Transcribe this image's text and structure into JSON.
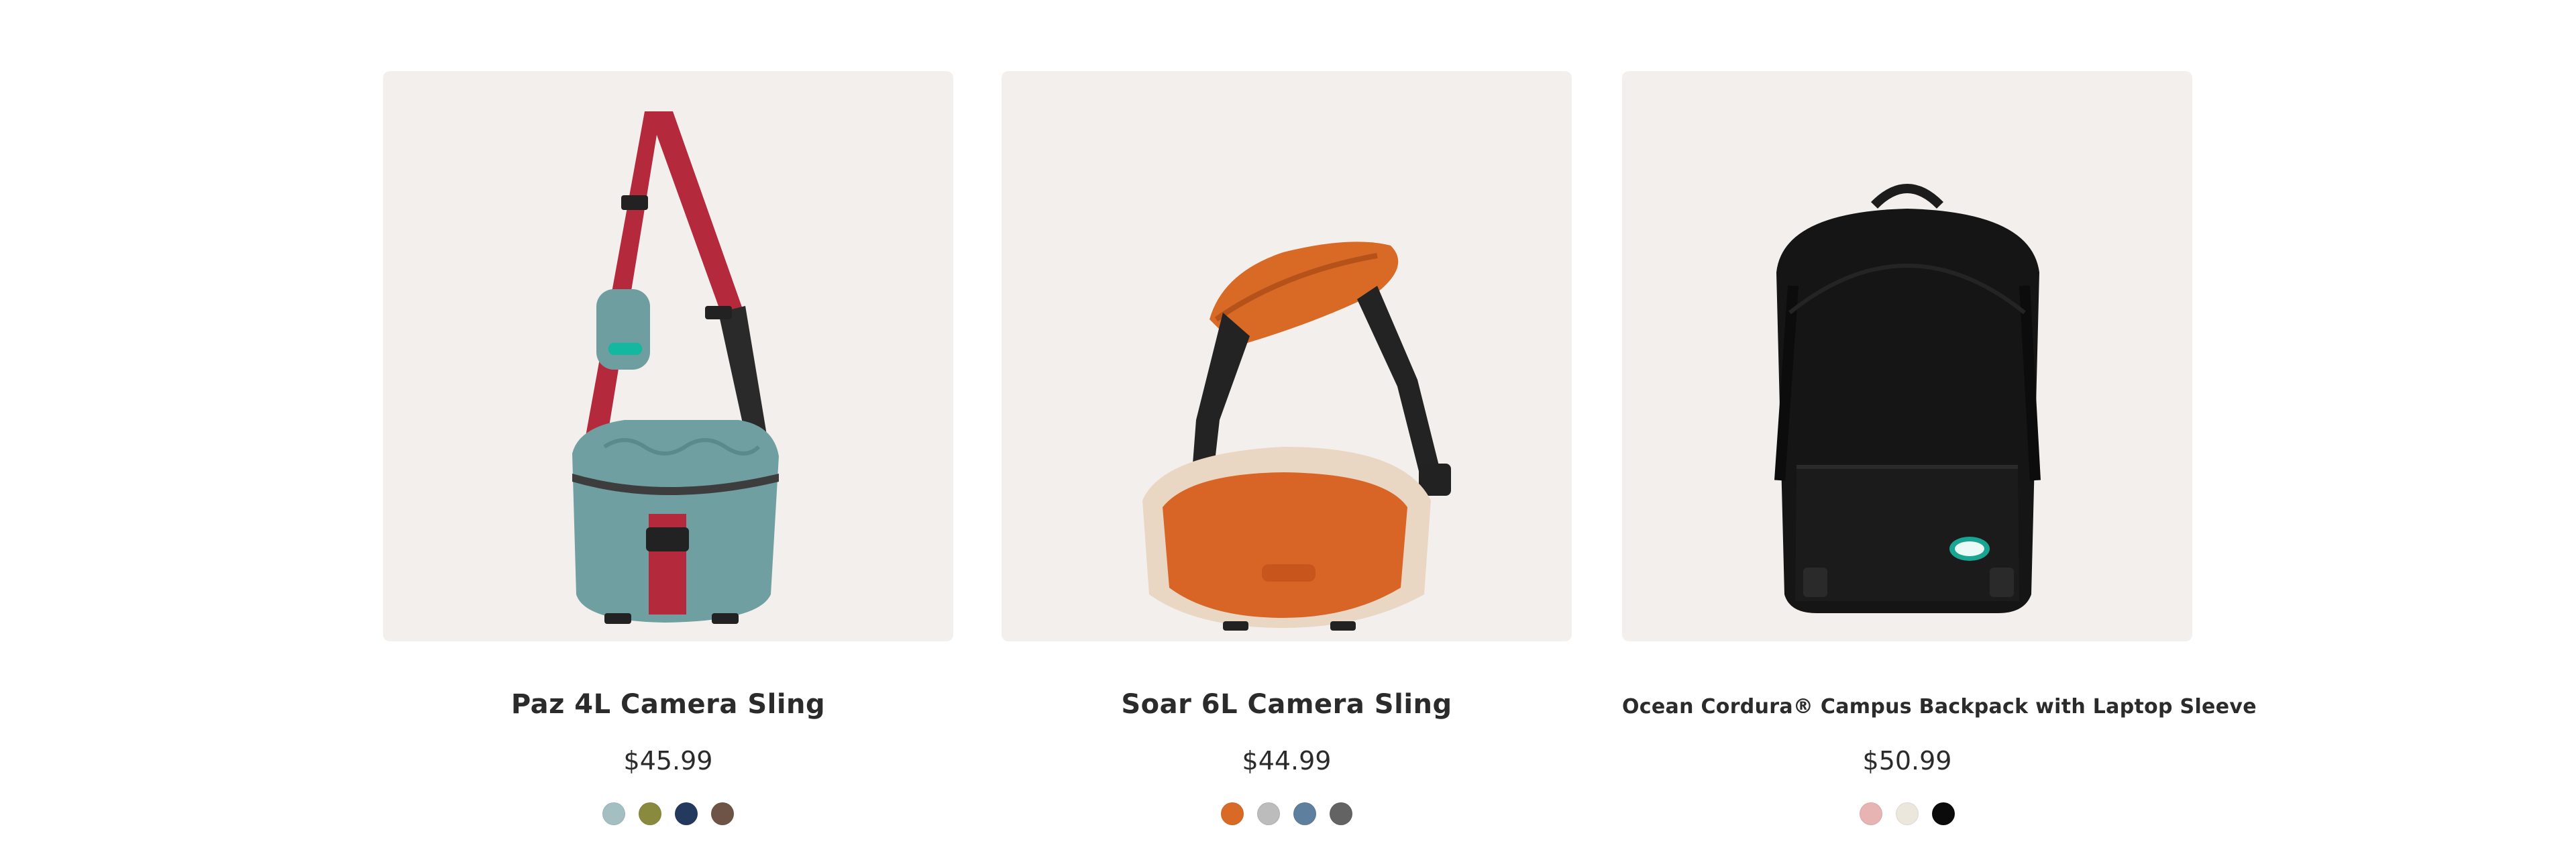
{
  "products": [
    {
      "name": "Paz 4L Camera Sling",
      "price": "$45.99",
      "image_icon": "camera-sling-bag-icon",
      "swatches": [
        "#a3bfc2",
        "#8a8a3e",
        "#233a5e",
        "#6e5446"
      ]
    },
    {
      "name": "Soar 6L Camera Sling",
      "price": "$44.99",
      "image_icon": "camera-sling-bag-icon",
      "swatches": [
        "#d96a26",
        "#bcbcbc",
        "#5f7f9e",
        "#636363"
      ]
    },
    {
      "name": "Ocean Cordura® Campus Backpack with Laptop Sleeve",
      "price": "$50.99",
      "image_icon": "backpack-icon",
      "swatches": [
        "#e8b3b3",
        "#ebe7dc",
        "#0b0b0b"
      ]
    }
  ],
  "colors": {
    "image_background": "#f3efec",
    "text": "#2b2b2b"
  }
}
